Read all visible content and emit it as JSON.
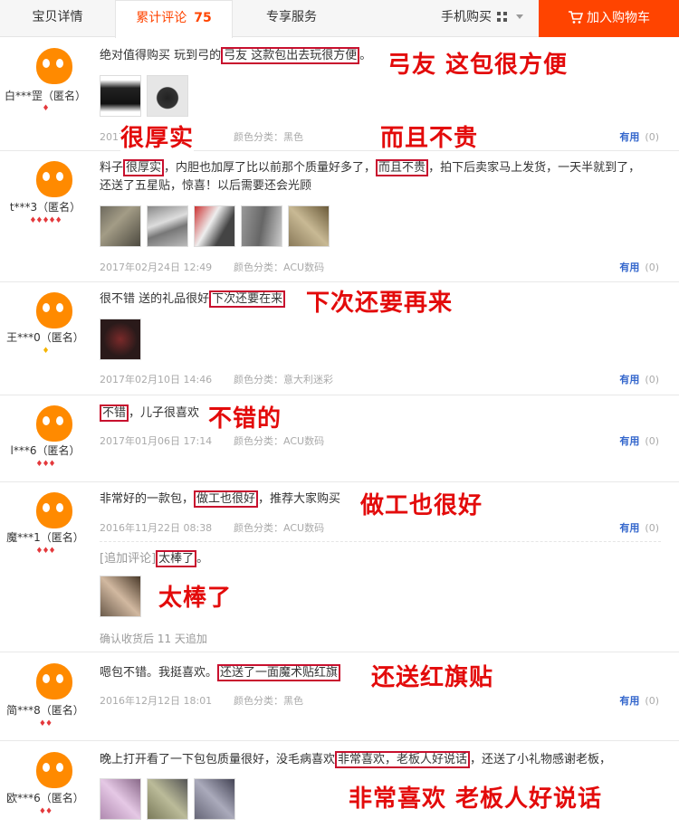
{
  "tabs": {
    "detail": "宝贝详情",
    "reviews": "累计评论",
    "review_count": "75",
    "exclusive": "专享服务",
    "mobile": "手机购买"
  },
  "cart": {
    "label": "加入购物车"
  },
  "colors": {
    "accent": "#ff4400",
    "annotation": "#e30b0b",
    "useful": "#3366cc"
  },
  "reviews": [
    {
      "user": "白***罡（匿名）",
      "rank": "♦",
      "text_a": "绝对值得购买 玩到弓的",
      "text_hl": "弓友 这款包出去玩很方便",
      "text_b": "。",
      "date": "2017",
      "color": "颜色分类：黑色",
      "useful": "有用",
      "count": "(0)"
    },
    {
      "user": "t***3（匿名）",
      "rank": "♦♦♦♦♦",
      "text_a": "料子",
      "text_hl": "很厚实",
      "text_b": "，内胆也加厚了比以前那个质量好多了，",
      "text_hl2": "而且不贵",
      "text_c": "，拍下后卖家马上发货，一天半就到了，",
      "text_line2": "还送了五星贴，惊喜！以后需要还会光顾",
      "date": "2017年02月24日 12:49",
      "color": "颜色分类：ACU数码",
      "useful": "有用",
      "count": "(0)"
    },
    {
      "user": "王***0（匿名）",
      "rank": "♦",
      "text_a": "很不错 送的礼品很好",
      "text_hl": "下次还要在来",
      "date": "2017年02月10日 14:46",
      "color": "颜色分类：意大利迷彩",
      "useful": "有用",
      "count": "(0)"
    },
    {
      "user": "l***6（匿名）",
      "rank": "♦♦♦",
      "text_hl": "不错",
      "text_b": "，儿子很喜欢",
      "date": "2017年01月06日 17:14",
      "color": "颜色分类：ACU数码",
      "useful": "有用",
      "count": "(0)"
    },
    {
      "user": "魔***1（匿名）",
      "rank": "♦♦♦",
      "text_a": "非常好的一款包，",
      "text_hl": "做工也很好",
      "text_b": "，推荐大家购买",
      "date": "2016年11月22日 08:38",
      "color": "颜色分类：ACU数码",
      "useful": "有用",
      "count": "(0)",
      "append_label": "[追加评论]",
      "append_hl": "太棒了",
      "append_b": "。",
      "append_note": "确认收货后 11 天追加"
    },
    {
      "user": "简***8（匿名）",
      "rank": "♦♦",
      "text_a": "嗯包不错。我挺喜欢。",
      "text_hl": "还送了一面魔术贴红旗",
      "date": "2016年12月12日 18:01",
      "color": "颜色分类：黑色",
      "useful": "有用",
      "count": "(0)"
    },
    {
      "user": "欧***6（匿名）",
      "rank": "♦♦",
      "text_a": "晚上打开看了一下包包质量很好，没毛病喜欢",
      "text_hl": "非常喜欢，老板人好说话",
      "text_b": "，还送了小礼物感谢老板，"
    }
  ],
  "annotations": [
    "弓友 这包很方便",
    "很厚实",
    "而且不贵",
    "下次还要再来",
    "不错的",
    "做工也很好",
    "太棒了",
    "还送红旗贴",
    "非常喜欢 老板人好说话"
  ]
}
